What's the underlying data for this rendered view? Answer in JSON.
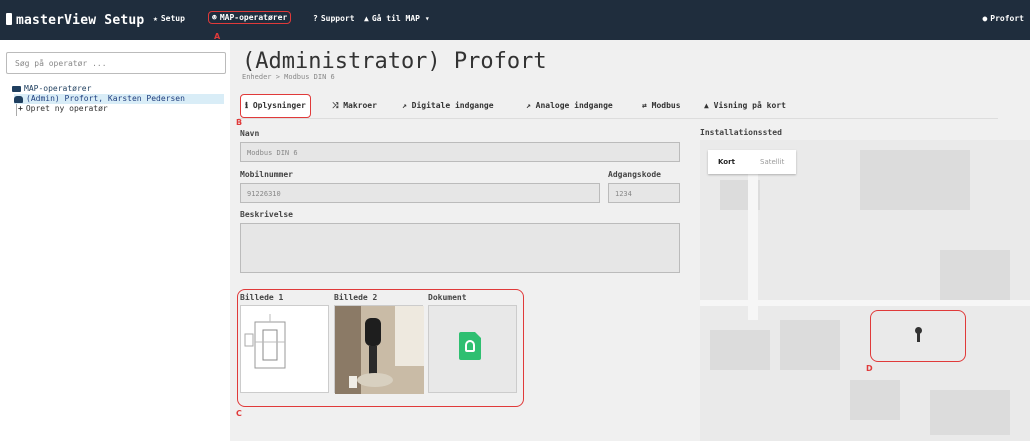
{
  "topbar": {
    "brand": "masterView Setup",
    "nav": {
      "setup": "Setup",
      "map_operators": "MAP-operatører",
      "support": "Support",
      "goto_map": "Gå til MAP",
      "user": "Profort"
    },
    "marker_a": "A"
  },
  "sidebar": {
    "search_placeholder": "Søg på operatør ...",
    "tree": {
      "root": "MAP-operatører",
      "selected": "(Admin) Profort, Karsten Pedersen",
      "create": "Opret ny operatør"
    }
  },
  "main": {
    "title": "(Administrator) Profort",
    "breadcrumb": "Enheder > Modbus DIN 6",
    "marker_b": "B",
    "tabs": [
      {
        "label": "Oplysninger",
        "icon": "info-icon"
      },
      {
        "label": "Makroer",
        "icon": "shuffle-icon"
      },
      {
        "label": "Digitale indgange",
        "icon": "arrow-icon"
      },
      {
        "label": "Analoge indgange",
        "icon": "arrow-icon"
      },
      {
        "label": "Modbus",
        "icon": "exchange-icon"
      },
      {
        "label": "Visning på kort",
        "icon": "map-icon"
      }
    ],
    "form": {
      "name_label": "Navn",
      "name_value": "Modbus DIN 6",
      "mobile_label": "Mobilnummer",
      "mobile_value": "91226310",
      "code_label": "Adgangskode",
      "code_value": "1234",
      "desc_label": "Beskrivelse",
      "desc_value": ""
    },
    "attachments": {
      "image1_label": "Billede 1",
      "image2_label": "Billede 2",
      "doc_label": "Dokument",
      "marker": "C"
    }
  },
  "map": {
    "label": "Installationssted",
    "toggle_map": "Kort",
    "toggle_sat": "Satellit",
    "marker": "D"
  }
}
